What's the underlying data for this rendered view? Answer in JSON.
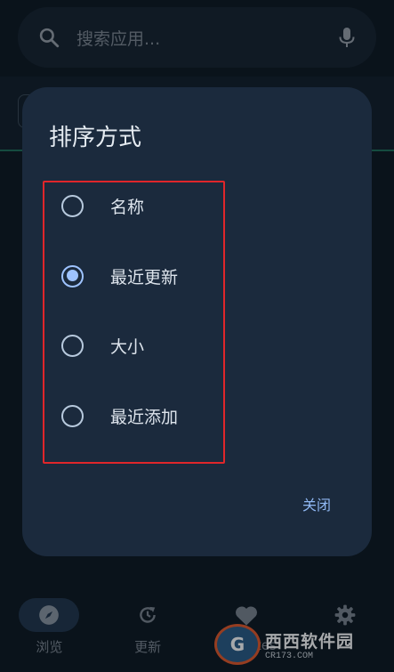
{
  "search": {
    "placeholder": "搜索应用...",
    "search_icon": "search-icon",
    "mic_icon": "microphone-icon"
  },
  "dialog": {
    "title": "排序方式",
    "options": [
      {
        "label": "名称",
        "selected": false
      },
      {
        "label": "最近更新",
        "selected": true
      },
      {
        "label": "大小",
        "selected": false
      },
      {
        "label": "最近添加",
        "selected": false
      }
    ],
    "close_label": "关闭"
  },
  "bottom_nav": {
    "items": [
      {
        "label": "浏览",
        "icon": "compass-icon",
        "active": true
      },
      {
        "label": "更新",
        "icon": "refresh-icon",
        "active": false
      },
      {
        "label": "Favorites",
        "icon": "heart-icon",
        "active": false
      },
      {
        "label": "",
        "icon": "gear-icon",
        "active": false
      }
    ]
  },
  "watermark": {
    "logo_text": "G",
    "title": "西西软件园",
    "subtitle": "CR173.COM"
  },
  "colors": {
    "background": "#0f1923",
    "dialog_bg": "#1b2a3d",
    "accent": "#9ec3ff",
    "highlight_border": "#e0262a"
  }
}
